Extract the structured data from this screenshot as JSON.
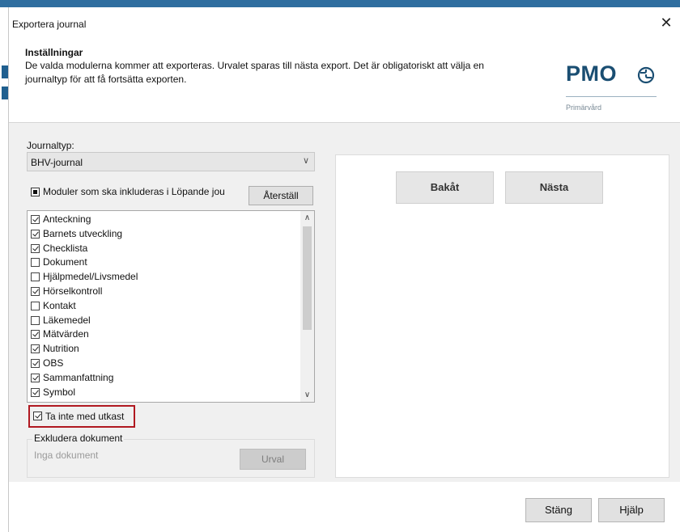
{
  "window": {
    "title": "Exportera journal"
  },
  "header": {
    "title": "Inställningar",
    "description": "De valda modulerna kommer att exporteras. Urvalet sparas till nästa export. Det är obligatoriskt att välja en journaltyp för att få fortsätta exporten."
  },
  "logo": {
    "brand": "PMO",
    "subtitle": "Primärvård",
    "color": "#1a4e72"
  },
  "journaltype": {
    "label": "Journaltyp:",
    "selected": "BHV-journal"
  },
  "modules": {
    "header_label": "Moduler som ska inkluderas i Löpande jou",
    "reset_label": "Återställ",
    "items": [
      {
        "label": "Anteckning",
        "checked": true
      },
      {
        "label": "Barnets utveckling",
        "checked": true
      },
      {
        "label": "Checklista",
        "checked": true
      },
      {
        "label": "Dokument",
        "checked": false
      },
      {
        "label": "Hjälpmedel/Livsmedel",
        "checked": false
      },
      {
        "label": "Hörselkontroll",
        "checked": true
      },
      {
        "label": "Kontakt",
        "checked": false
      },
      {
        "label": "Läkemedel",
        "checked": false
      },
      {
        "label": "Mätvärden",
        "checked": true
      },
      {
        "label": "Nutrition",
        "checked": true
      },
      {
        "label": "OBS",
        "checked": true
      },
      {
        "label": "Sammanfattning",
        "checked": true
      },
      {
        "label": "Symbol",
        "checked": true
      }
    ]
  },
  "draft_option": {
    "label": "Ta inte med utkast",
    "checked": true,
    "highlight_color": "#b01820"
  },
  "exclude": {
    "legend": "Exkludera dokument",
    "empty_text": "Inga dokument",
    "select_label": "Urval"
  },
  "navigation": {
    "back_label": "Bakåt",
    "next_label": "Nästa"
  },
  "footer": {
    "close_label": "Stäng",
    "help_label": "Hjälp"
  }
}
